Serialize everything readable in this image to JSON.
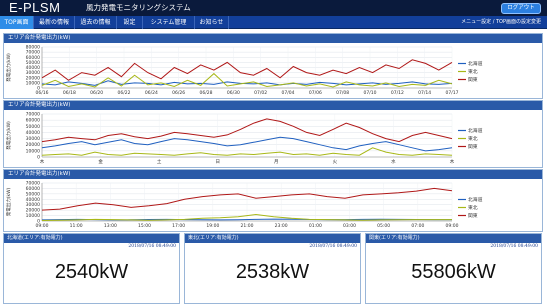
{
  "header": {
    "logo": "E-PLSM",
    "subtitle": "風力発電モニタリングシステム",
    "logout_label": "ログアウト"
  },
  "nav": {
    "items": [
      {
        "label": "TOP画面",
        "active": true
      },
      {
        "label": "最新の情報",
        "active": false
      },
      {
        "label": "過去の情報",
        "active": false
      },
      {
        "label": "設定",
        "active": false
      },
      {
        "label": "システム管理",
        "active": false
      },
      {
        "label": "お知らせ",
        "active": false
      }
    ],
    "right_text": "メニュー設定 / TOP画面の設定変更"
  },
  "colors": {
    "hokkaido": "#2060c0",
    "tohoku": "#a8b818",
    "kanto": "#b01818",
    "accent": "#2a5aa8"
  },
  "chart_data": [
    {
      "type": "line",
      "title": "エリア合計発電出力(kW)",
      "ylabel": "発電出力(kW)",
      "x": [
        "06/16",
        "06/18",
        "06/20",
        "06/22",
        "06/24",
        "06/26",
        "06/28",
        "06/30",
        "07/02",
        "07/04",
        "07/06",
        "07/08",
        "07/10",
        "07/12",
        "07/14",
        "07/17"
      ],
      "yticks": [
        0,
        10000,
        20000,
        30000,
        40000,
        50000,
        60000,
        70000,
        80000
      ],
      "ylim": [
        0,
        80000
      ],
      "legend": [
        "北海道",
        "東北",
        "関東"
      ],
      "legend_position": "right",
      "grid": true,
      "series": [
        {
          "name": "北海道",
          "values": [
            8000,
            6000,
            12000,
            9000,
            5000,
            14000,
            7000,
            10000,
            9000,
            6000,
            11000,
            8000,
            9000,
            7000,
            12000,
            9000,
            8000,
            10000,
            6000,
            9000,
            7000,
            11000,
            9000,
            6000,
            8000,
            10000,
            7000,
            9000,
            12000,
            8000,
            7000,
            9000
          ]
        },
        {
          "name": "東北",
          "values": [
            5000,
            15000,
            3000,
            8000,
            2000,
            20000,
            4000,
            25000,
            6000,
            10000,
            3000,
            15000,
            5000,
            28000,
            4000,
            8000,
            12000,
            3000,
            6000,
            10000,
            4000,
            8000,
            2000,
            12000,
            6000,
            4000,
            10000,
            3000,
            7000,
            5000,
            15000,
            8000
          ]
        },
        {
          "name": "関東",
          "values": [
            20000,
            35000,
            15000,
            30000,
            25000,
            40000,
            22000,
            48000,
            30000,
            18000,
            40000,
            28000,
            45000,
            35000,
            50000,
            30000,
            25000,
            38000,
            20000,
            42000,
            30000,
            25000,
            35000,
            28000,
            40000,
            30000,
            45000,
            38000,
            55000,
            48000,
            35000,
            50000
          ]
        }
      ]
    },
    {
      "type": "line",
      "title": "エリア合計発電出力(kW)",
      "ylabel": "発電出力(kW)",
      "x": [
        "木",
        "金",
        "土",
        "日",
        "月",
        "火",
        "水",
        "木"
      ],
      "yticks": [
        0,
        10000,
        20000,
        30000,
        40000,
        50000,
        60000,
        70000
      ],
      "ylim": [
        0,
        70000
      ],
      "legend": [
        "北海道",
        "東北",
        "関東"
      ],
      "legend_position": "right",
      "grid": true,
      "series": [
        {
          "name": "北海道",
          "values": [
            15000,
            18000,
            22000,
            25000,
            20000,
            24000,
            28000,
            22000,
            20000,
            25000,
            30000,
            28000,
            25000,
            22000,
            18000,
            20000,
            24000,
            28000,
            32000,
            30000,
            25000,
            20000,
            15000,
            12000,
            18000,
            22000,
            25000,
            20000,
            15000,
            10000,
            12000,
            15000
          ]
        },
        {
          "name": "東北",
          "values": [
            3000,
            4000,
            5000,
            3000,
            8000,
            4000,
            3000,
            6000,
            5000,
            4000,
            3000,
            5000,
            7000,
            4000,
            3000,
            5000,
            4000,
            6000,
            8000,
            4000,
            5000,
            3000,
            6000,
            4000,
            3000,
            15000,
            8000,
            4000,
            3000,
            5000,
            4000,
            3000
          ]
        },
        {
          "name": "関東",
          "values": [
            25000,
            28000,
            32000,
            30000,
            28000,
            35000,
            38000,
            33000,
            30000,
            34000,
            40000,
            38000,
            35000,
            32000,
            36000,
            45000,
            55000,
            62000,
            58000,
            50000,
            40000,
            35000,
            45000,
            55000,
            48000,
            38000,
            30000,
            25000,
            35000,
            40000,
            35000,
            30000
          ]
        }
      ]
    },
    {
      "type": "line",
      "title": "エリア合計発電出力(kW)",
      "ylabel": "発電出力(kW)",
      "x": [
        "09:00",
        "11:00",
        "13:00",
        "15:00",
        "17:00",
        "19:00",
        "21:00",
        "23:00",
        "01:00",
        "03:00",
        "05:00",
        "07:00",
        "09:00"
      ],
      "yticks": [
        0,
        10000,
        20000,
        30000,
        40000,
        50000,
        60000,
        70000
      ],
      "ylim": [
        0,
        70000
      ],
      "legend": [
        "北海道",
        "東北",
        "関東"
      ],
      "legend_position": "right",
      "grid": true,
      "series": [
        {
          "name": "北海道",
          "values": [
            2000,
            2500,
            3000,
            2500,
            2000,
            2200,
            2800,
            3000,
            2500,
            2200,
            2000,
            2400,
            3000,
            3500,
            3200,
            2800,
            2500,
            2600,
            3000,
            3400,
            3000,
            2800,
            2600,
            2540
          ]
        },
        {
          "name": "東北",
          "values": [
            1000,
            1500,
            2000,
            3000,
            2500,
            2000,
            1500,
            2000,
            3000,
            5000,
            6000,
            8000,
            12000,
            8000,
            5000,
            3000,
            2500,
            2000,
            1500,
            2000,
            2200,
            2500,
            2500,
            2538
          ]
        },
        {
          "name": "関東",
          "values": [
            20000,
            22000,
            28000,
            33000,
            30000,
            25000,
            28000,
            32000,
            40000,
            45000,
            48000,
            50000,
            42000,
            45000,
            48000,
            50000,
            45000,
            42000,
            48000,
            50000,
            52000,
            55000,
            60000,
            55806
          ]
        }
      ]
    }
  ],
  "values": [
    {
      "title": "北海道(エリア:有効電力)",
      "time": "2018/07/16 08:49:00",
      "value": "2540kW"
    },
    {
      "title": "東北(エリア:有効電力)",
      "time": "2018/07/16 08:49:00",
      "value": "2538kW"
    },
    {
      "title": "関東(エリア:有効電力)",
      "time": "2018/07/16 08:49:00",
      "value": "55806kW"
    }
  ]
}
